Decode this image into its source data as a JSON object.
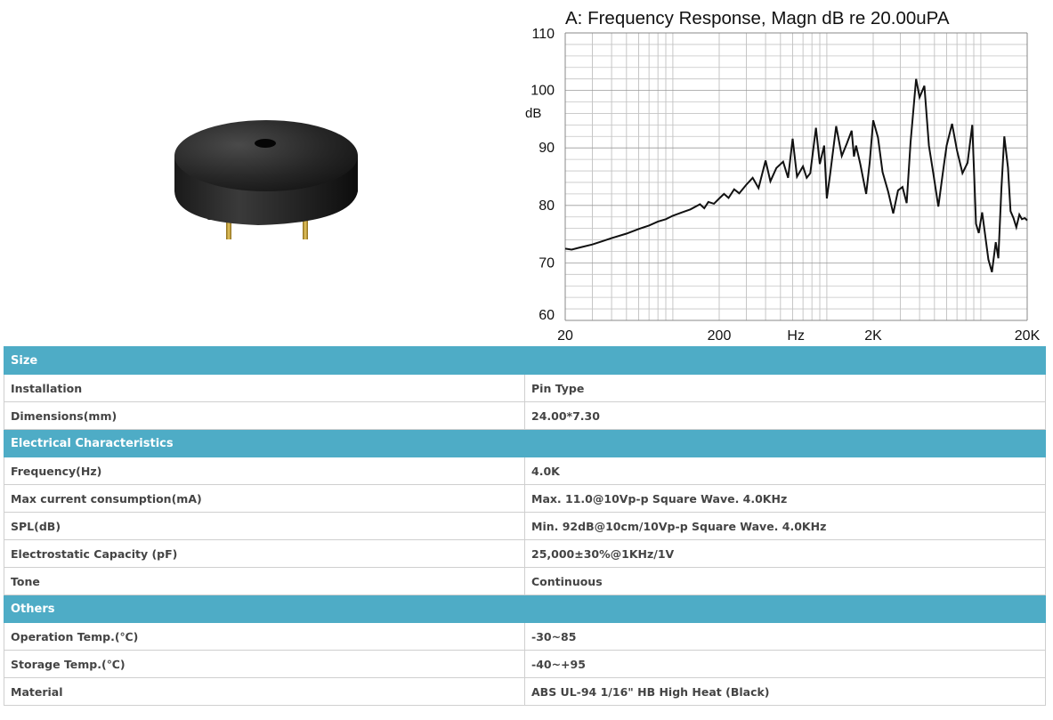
{
  "product_image": {
    "icon": "buzzer-photo"
  },
  "chart_data": {
    "type": "line",
    "title": "A: Frequency Response, Magn dB re 20.00uPA",
    "ylabel": "dB",
    "xlabel": "",
    "x_scale": "log",
    "xlim": [
      20,
      20000
    ],
    "ylim": [
      60,
      110
    ],
    "x_ticks": [
      "20",
      "200",
      "Hz",
      "2K",
      "20K"
    ],
    "y_ticks": [
      "110",
      "100",
      "90",
      "80",
      "70",
      "60"
    ],
    "grid": true,
    "line_color": "#111111",
    "series": [
      {
        "x": [
          20,
          22,
          25,
          30,
          35,
          40,
          50,
          60,
          70,
          80,
          90,
          100,
          115,
          130,
          150,
          160,
          170,
          185,
          200,
          215,
          230,
          250,
          270,
          300,
          330,
          360,
          400,
          430,
          470,
          520,
          560,
          600,
          640,
          700,
          740,
          780,
          850,
          900,
          960,
          1000,
          1050,
          1150,
          1250,
          1350,
          1450,
          1500,
          1550,
          1650,
          1800,
          1900,
          2000,
          2150,
          2300,
          2500,
          2700,
          2900,
          3100,
          3300,
          3500,
          3800,
          4000,
          4300,
          4600,
          4900,
          5300,
          5700,
          6000,
          6500,
          7000,
          7600,
          8200,
          8800,
          9300,
          9700,
          10200,
          10700,
          11200,
          11800,
          12500,
          13000,
          13600,
          14200,
          15000,
          15600,
          16300,
          17000,
          17800,
          18500,
          19300,
          20000
        ],
        "values": [
          72.5,
          72.3,
          72.7,
          73.2,
          73.8,
          74.3,
          75.1,
          75.9,
          76.5,
          77.2,
          77.6,
          78.2,
          78.8,
          79.3,
          80.2,
          79.5,
          80.6,
          80.3,
          81.2,
          82.0,
          81.3,
          82.8,
          82.1,
          83.6,
          84.8,
          83.0,
          87.8,
          84.2,
          86.5,
          87.6,
          84.8,
          91.6,
          85.0,
          86.8,
          84.8,
          85.6,
          93.5,
          87.2,
          90.4,
          81.2,
          85.4,
          93.8,
          88.6,
          90.8,
          93.0,
          88.5,
          90.4,
          87.2,
          82.0,
          87.5,
          94.8,
          91.8,
          85.8,
          82.4,
          78.6,
          82.6,
          83.2,
          80.4,
          91.0,
          102.0,
          98.8,
          100.8,
          90.4,
          85.8,
          79.8,
          86.2,
          90.4,
          94.2,
          89.6,
          85.6,
          87.4,
          94.0,
          76.8,
          75.2,
          78.8,
          74.6,
          70.6,
          68.4,
          73.6,
          70.8,
          82.8,
          92.0,
          86.6,
          79.0,
          77.8,
          76.2,
          78.4,
          77.6,
          77.8,
          77.4
        ]
      }
    ]
  },
  "table": {
    "sections": [
      {
        "title": "Size",
        "rows": [
          {
            "label": "Installation",
            "value": "Pin Type"
          },
          {
            "label": "Dimensions(mm)",
            "value": "24.00*7.30"
          }
        ]
      },
      {
        "title": "Electrical Characteristics",
        "rows": [
          {
            "label": "Frequency(Hz)",
            "value": "4.0K"
          },
          {
            "label": "Max current consumption(mA)",
            "value": "Max. 11.0@10Vp-p Square Wave. 4.0KHz"
          },
          {
            "label": "SPL(dB)",
            "value": "Min. 92dB@10cm/10Vp-p Square Wave. 4.0KHz"
          },
          {
            "label": "Electrostatic Capacity (pF)",
            "value": "25,000±30%@1KHz/1V"
          },
          {
            "label": "Tone",
            "value": "Continuous"
          }
        ]
      },
      {
        "title": "Others",
        "rows": [
          {
            "label": "Operation Temp.(℃)",
            "value": "-30~85"
          },
          {
            "label": "Storage Temp.(℃)",
            "value": "-40~+95"
          },
          {
            "label": "Material",
            "value": "ABS UL-94 1/16\" HB High Heat (Black)"
          }
        ]
      }
    ],
    "header_color": "#4eacc6"
  }
}
